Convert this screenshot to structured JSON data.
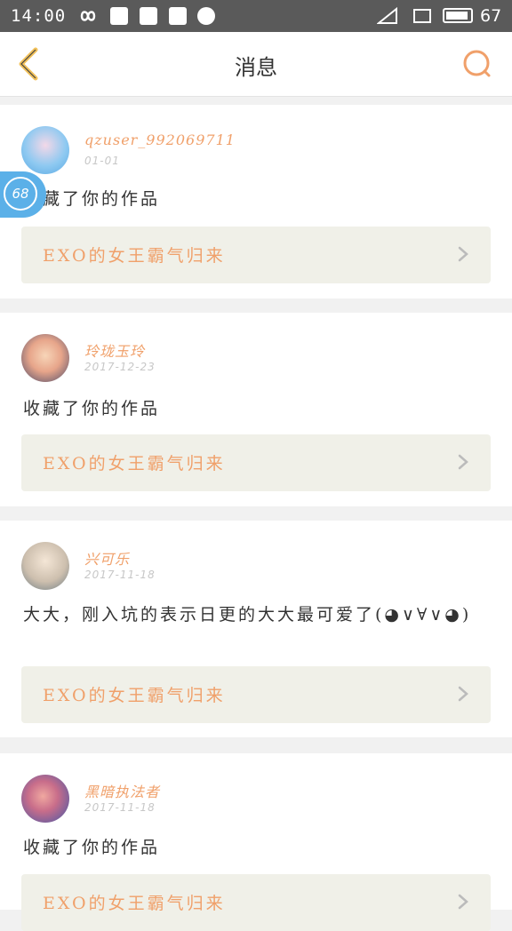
{
  "status_bar": {
    "time": "14:00",
    "battery": "67"
  },
  "header": {
    "title": "消息"
  },
  "floating_badge": {
    "value": "68"
  },
  "messages": [
    {
      "username": "qzuser_992069711",
      "date": "01-01",
      "text": "收藏了你的作品",
      "work_title": "EXO的女王霸气归来"
    },
    {
      "username": "玲珑玉玲",
      "date": "2017-12-23",
      "text": "收藏了你的作品",
      "work_title": "EXO的女王霸气归来"
    },
    {
      "username": "兴可乐",
      "date": "2017-11-18",
      "text": "大大，刚入坑的表示日更的大大最可爱了(◕∨∀∨◕)",
      "work_title": "EXO的女王霸气归来"
    },
    {
      "username": "黑暗执法者",
      "date": "2017-11-18",
      "text": "收藏了你的作品",
      "work_title": "EXO的女王霸气归来"
    }
  ],
  "colors": {
    "accent": "#f0a06a",
    "back_arrow": "#f2c15a",
    "badge": "#5bb0e8"
  }
}
